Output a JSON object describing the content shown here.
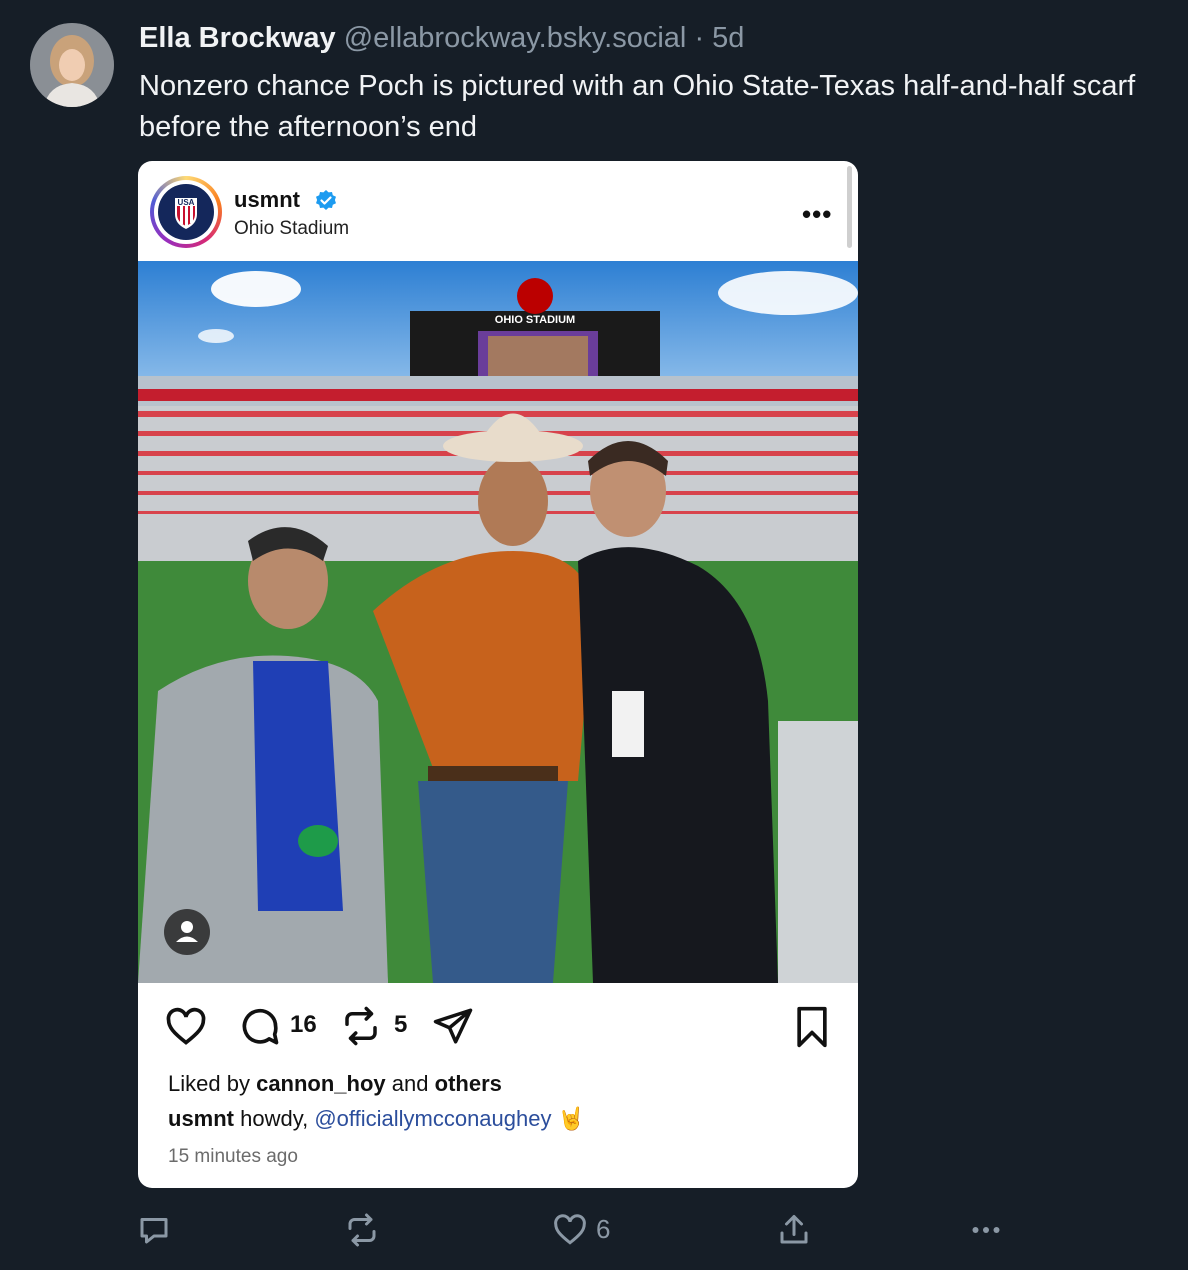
{
  "post": {
    "author_name": "Ella Brockway",
    "handle": "@ellabrockway.bsky.social",
    "separator": "·",
    "age": "5d",
    "text": "Nonzero chance Poch is pictured with an Ohio State-Texas half-and-half scarf before the afternoon’s end"
  },
  "embed": {
    "username": "usmnt",
    "location": "Ohio Stadium",
    "logo_text": "USA",
    "scoreboard_text": "OHIO STADIUM",
    "comments_count": "16",
    "reposts_count": "5",
    "likes_prefix": "Liked by",
    "likes_user": "cannon_hoy",
    "likes_and": "and",
    "likes_others": "others",
    "caption_user": "usmnt",
    "caption_text": "howdy,",
    "caption_mention": "@officiallymcconaughey",
    "caption_emoji": "🤘",
    "time": "15 minutes ago"
  },
  "footer": {
    "likes_count": "6"
  },
  "icons": {
    "verified": "verified-badge-icon",
    "heart": "heart-icon",
    "comment": "comment-icon",
    "repost": "repost-icon",
    "share": "send-icon",
    "bookmark": "bookmark-icon",
    "person": "person-tag-icon"
  },
  "colors": {
    "background": "#161e27",
    "muted": "#8b98a5",
    "verified": "#1d9bf0",
    "mention": "#2c4e9c"
  }
}
